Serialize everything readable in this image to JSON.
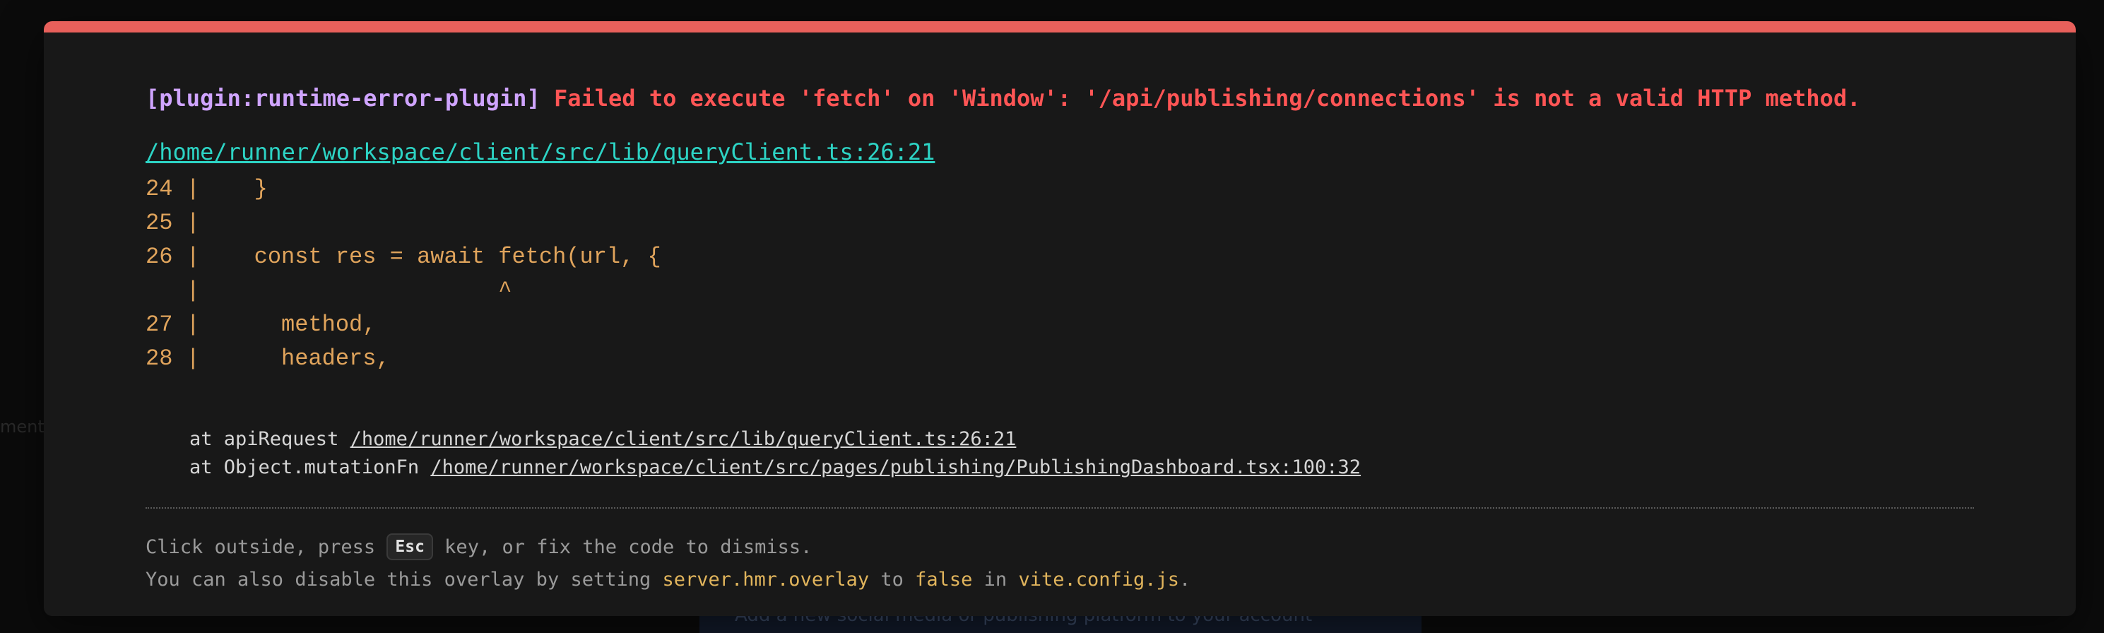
{
  "background": {
    "left_text": "ment",
    "panel_text": "Add a new social media or publishing platform to your account"
  },
  "overlay": {
    "accent_color": "#e8605b",
    "plugin_tag": "[plugin:runtime-error-plugin]",
    "error_message": "Failed to execute 'fetch' on 'Window': '/api/publishing/connections' is not a valid HTTP method.",
    "file_link": "/home/runner/workspace/client/src/lib/queryClient.ts:26:21",
    "code_frame": [
      "24 |    }",
      "25 |",
      "26 |    const res = await fetch(url, {",
      "   |                      ^",
      "27 |      method,",
      "28 |      headers,"
    ],
    "stack": [
      {
        "prefix": "at apiRequest ",
        "path": "/home/runner/workspace/client/src/lib/queryClient.ts:26:21"
      },
      {
        "prefix": "at Object.mutationFn ",
        "path": "/home/runner/workspace/client/src/pages/publishing/PublishingDashboard.tsx:100:32"
      }
    ],
    "tip": {
      "line1_before": "Click outside, press ",
      "key": "Esc",
      "line1_after": " key, or fix the code to dismiss.",
      "line2_a": "You can also disable this overlay by setting ",
      "line2_setting": "server.hmr.overlay",
      "line2_b": " to ",
      "line2_value": "false",
      "line2_c": " in ",
      "line2_file": "vite.config.js",
      "line2_d": "."
    }
  }
}
